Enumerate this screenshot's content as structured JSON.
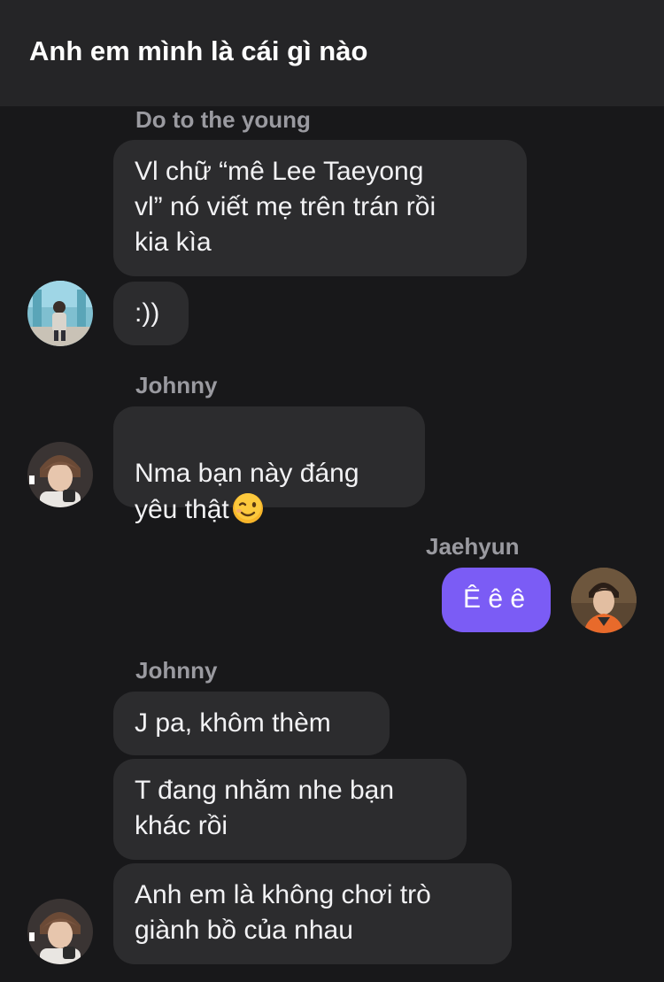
{
  "header": {
    "title": "Anh em mình là cái gì nào"
  },
  "messages": [
    {
      "sender": "Do to the young",
      "bubbles": [
        "Vl chữ “mê Lee Taeyong\nvl” nó viết mẹ trên trán rồi\nkia kìa",
        ":))"
      ]
    },
    {
      "sender": "Johnny",
      "bubbles": [
        "Nma bạn này đáng\nyêu thật"
      ],
      "emoji": "winking-face-emoji"
    },
    {
      "sender": "Jaehyun",
      "bubbles": [
        "Ê ê ê"
      ]
    },
    {
      "sender": "Johnny",
      "bubbles": [
        "J pa, khôm thèm",
        "T đang nhăm nhe bạn\nkhác rồi",
        "Anh em là không chơi trò\ngiành bồ của nhau"
      ]
    }
  ],
  "colors": {
    "background": "#18181a",
    "header": "#252527",
    "incoming_bubble": "#2c2c2e",
    "outgoing_bubble": "#7b5cf5",
    "sender_name": "#9a9aa0"
  }
}
